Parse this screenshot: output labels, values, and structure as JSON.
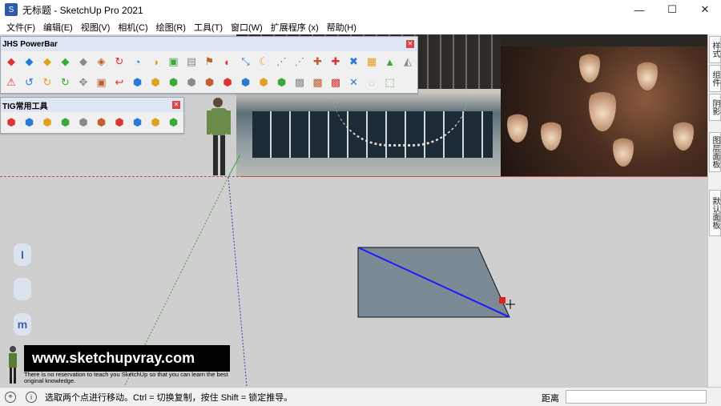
{
  "window": {
    "title": "无标题 - SketchUp Pro 2021",
    "minimize": "—",
    "maximize": "☐",
    "close": "✕"
  },
  "menu": [
    "文件(F)",
    "编辑(E)",
    "视图(V)",
    "相机(C)",
    "绘图(R)",
    "工具(T)",
    "窗口(W)",
    "扩展程序 (x)",
    "帮助(H)"
  ],
  "jhs_toolbar": {
    "title": "JHS PowerBar",
    "row1": [
      "◆",
      "◆",
      "◆",
      "◆",
      "◆",
      "◈",
      "↻",
      "◔",
      "◑",
      "▣",
      "▤",
      "⚑",
      "◐",
      "⤡",
      "☾",
      "⋰",
      "⋰",
      "✚",
      "✚",
      "✖",
      "▦",
      "▲",
      "◭"
    ],
    "row2": [
      "⚠",
      "↺",
      "↻",
      "↻",
      "✥",
      "▣",
      "↩",
      "⬢",
      "⬢",
      "⬢",
      "⬢",
      "⬢",
      "⬢",
      "⬢",
      "⬢",
      "⬢",
      "▩",
      "▩",
      "▩",
      "✕",
      "◌",
      "⬚"
    ]
  },
  "tig_toolbar": {
    "title": "TIG常用工具",
    "tools": [
      "⬢",
      "⬢",
      "⬢",
      "⬢",
      "⬢",
      "⬢",
      "⬢",
      "⬢",
      "⬢",
      "⬢"
    ]
  },
  "shortcuts": [
    "I",
    "",
    "m"
  ],
  "right_tabs": [
    "样式",
    "组件",
    "阴影",
    "图层面板",
    "默认面板"
  ],
  "watermark": {
    "url": "www.sketchupvray.com",
    "sub": "There is no reservation to teach you SketchUp so that you can learn the best original knowledge."
  },
  "status": {
    "text": "选取两个点进行移动。Ctrl = 切换复制，按住 Shift = 锁定推导。",
    "measure_label": "距离",
    "measure_value": ""
  },
  "colors": {
    "viewport": "#cfcfcf",
    "face": "#7c8a95",
    "edge_selected": "#1a1aff",
    "axis_red": "#cc4444",
    "axis_green": "#3aa83a",
    "axis_blue": "#3a3aaa"
  }
}
